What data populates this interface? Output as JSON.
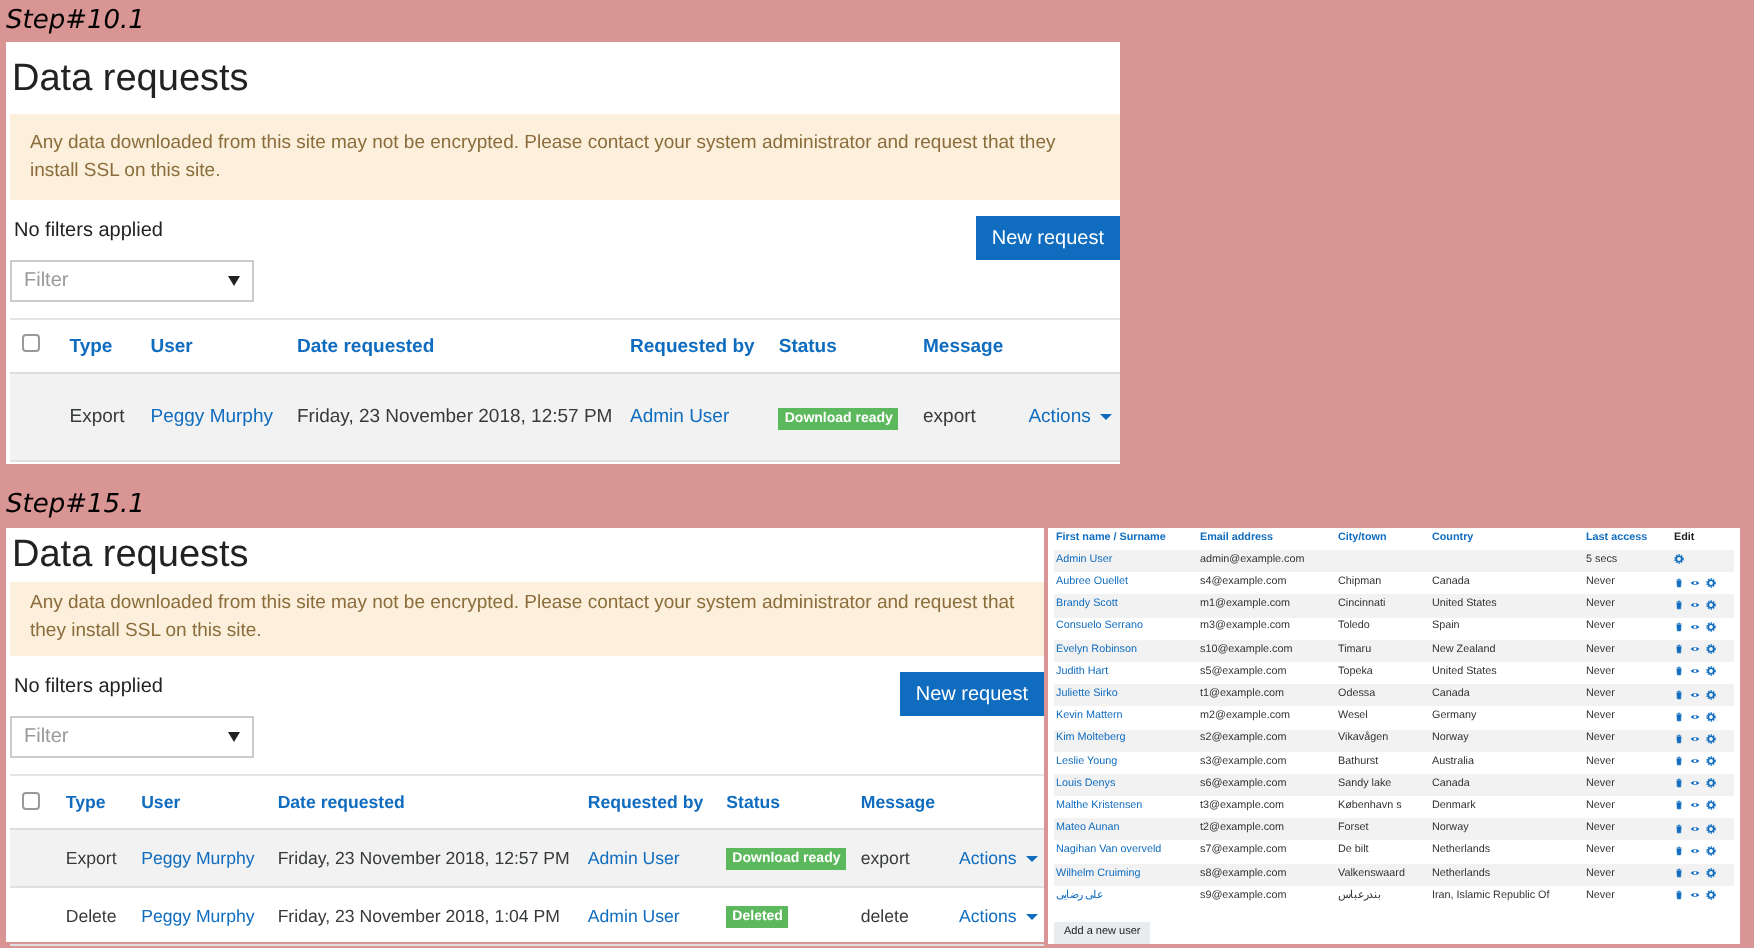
{
  "steps": [
    {
      "label": "Step#10.1",
      "page": {
        "title": "Data requests",
        "alert": "Any data downloaded from this site may not be encrypted. Please contact your system administrator and request that they install SSL on this site.",
        "filter_summary": "No filters applied",
        "new_button": "New request",
        "filter": {
          "placeholder": "Filter"
        },
        "table": {
          "select_all": {
            "checked": false
          },
          "columns": [
            "Type",
            "User",
            "Date requested",
            "Requested by",
            "Status",
            "Message"
          ],
          "rows": [
            {
              "type": "Export",
              "user": "Peggy Murphy",
              "date": "Friday, 23 November 2018, 12:57 PM",
              "requested_by": "Admin User",
              "status": {
                "label": "Download ready"
              },
              "message": "export",
              "actions": "Actions"
            }
          ]
        }
      }
    },
    {
      "label": "Step#15.1",
      "page": {
        "title": "Data requests",
        "alert": "Any data downloaded from this site may not be encrypted. Please contact your system administrator and request that they install SSL on this site.",
        "filter_summary": "No filters applied",
        "new_button": "New request",
        "filter": {
          "placeholder": "Filter"
        },
        "table": {
          "select_all": {
            "checked": false
          },
          "columns": [
            "Type",
            "User",
            "Date requested",
            "Requested by",
            "Status",
            "Message"
          ],
          "rows": [
            {
              "type": "Export",
              "user": "Peggy Murphy",
              "date": "Friday, 23 November 2018, 12:57 PM",
              "requested_by": "Admin User",
              "status": {
                "label": "Download ready"
              },
              "message": "export",
              "actions": "Actions"
            },
            {
              "type": "Delete",
              "user": "Peggy Murphy",
              "date": "Friday, 23 November 2018, 1:04 PM",
              "requested_by": "Admin User",
              "status": {
                "label": "Deleted"
              },
              "message": "delete",
              "actions": "Actions"
            }
          ]
        }
      },
      "users_table": {
        "columns": [
          "First name / Surname",
          "Email address",
          "City/town",
          "Country",
          "Last access",
          "Edit"
        ],
        "rows": [
          {
            "name": "Admin User",
            "email": "admin@example.com",
            "city": "",
            "country": "",
            "last_access": "5 secs",
            "deletable": false
          },
          {
            "name": "Aubree Ouellet",
            "email": "s4@example.com",
            "city": "Chipman",
            "country": "Canada",
            "last_access": "Never",
            "deletable": true
          },
          {
            "name": "Brandy Scott",
            "email": "m1@example.com",
            "city": "Cincinnati",
            "country": "United States",
            "last_access": "Never",
            "deletable": true
          },
          {
            "name": "Consuelo Serrano",
            "email": "m3@example.com",
            "city": "Toledo",
            "country": "Spain",
            "last_access": "Never",
            "deletable": true
          },
          {
            "name": "Evelyn Robinson",
            "email": "s10@example.com",
            "city": "Timaru",
            "country": "New Zealand",
            "last_access": "Never",
            "deletable": true
          },
          {
            "name": "Judith Hart",
            "email": "s5@example.com",
            "city": "Topeka",
            "country": "United States",
            "last_access": "Never",
            "deletable": true
          },
          {
            "name": "Juliette Sirko",
            "email": "t1@example.com",
            "city": "Odessa",
            "country": "Canada",
            "last_access": "Never",
            "deletable": true
          },
          {
            "name": "Kevin Mattern",
            "email": "m2@example.com",
            "city": "Wesel",
            "country": "Germany",
            "last_access": "Never",
            "deletable": true
          },
          {
            "name": "Kim Molteberg",
            "email": "s2@example.com",
            "city": "Vikavågen",
            "country": "Norway",
            "last_access": "Never",
            "deletable": true
          },
          {
            "name": "Leslie Young",
            "email": "s3@example.com",
            "city": "Bathurst",
            "country": "Australia",
            "last_access": "Never",
            "deletable": true
          },
          {
            "name": "Louis Denys",
            "email": "s6@example.com",
            "city": "Sandy lake",
            "country": "Canada",
            "last_access": "Never",
            "deletable": true
          },
          {
            "name": "Malthe Kristensen",
            "email": "t3@example.com",
            "city": "København s",
            "country": "Denmark",
            "last_access": "Never",
            "deletable": true
          },
          {
            "name": "Mateo Aunan",
            "email": "t2@example.com",
            "city": "Forset",
            "country": "Norway",
            "last_access": "Never",
            "deletable": true
          },
          {
            "name": "Nagihan Van overveld",
            "email": "s7@example.com",
            "city": "De bilt",
            "country": "Netherlands",
            "last_access": "Never",
            "deletable": true
          },
          {
            "name": "Wilhelm Cruiming",
            "email": "s8@example.com",
            "city": "Valkenswaard",
            "country": "Netherlands",
            "last_access": "Never",
            "deletable": true
          },
          {
            "name": "علی رضایی",
            "email": "s9@example.com",
            "city": "بندرعباس",
            "country": "Iran, Islamic Republic Of",
            "last_access": "Never",
            "deletable": true
          }
        ],
        "add_button": "Add a new user"
      }
    }
  ]
}
